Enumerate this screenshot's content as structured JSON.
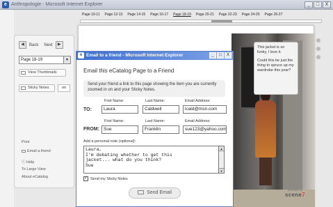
{
  "window": {
    "title": "Anthropologie - Microsoft Internet Explorer",
    "minimize": "_",
    "maximize": "□",
    "close": "X"
  },
  "page_tabs": [
    "Page 10-11",
    "Page 12-13",
    "Page 14-15",
    "Page 16-17",
    "Page 18-19",
    "Page 20-21",
    "Page 22-23",
    "Page 24-25",
    "Page 26-27"
  ],
  "active_page_tab": "Page 18-19",
  "panel": {
    "back_label": "Back",
    "next_label": "Next",
    "page_select_value": "Page 18-19",
    "view_thumbnails": "View Thumbnails",
    "sticky_notes": "Sticky Notes",
    "sticky_state": "on",
    "print": "Print",
    "email_friend": "Email a friend",
    "help": "Help",
    "larger_view": "To Large View",
    "about": "About eCatalog"
  },
  "sticky_note": {
    "line1": "This jacket is so funky, I love it.",
    "line2": "Could this be just the thing to spruce up my wardrobe this year?"
  },
  "powered_by": {
    "caption": "powered by",
    "brand": "scene",
    "brand_accent": "7"
  },
  "dialog": {
    "title": "Email to a friend - Microsoft Internet Explorer",
    "heading": "Email this eCatalog Page to a Friend",
    "description": "Send your friend a link to this page showing the item you are currently zoomed in on and your Sticky Notes.",
    "col_first": "First Name:",
    "col_last": "Last Name:",
    "col_email": "Email Address:",
    "to_label": "TO:",
    "from_label": "FROM:",
    "to": {
      "first": "Laura",
      "last": "Caldwell",
      "email": "lcald@msn.com"
    },
    "from": {
      "first": "Sue",
      "last": "Franklin",
      "email": "sue123@yahoo.com"
    },
    "note_caption": "Add a personal note (optional):",
    "note_text": "Laura,\nI'm debating whether to get this\njacket... what do you think?\nSue",
    "send_sticky_label": "Send my Sticky Notes",
    "send_sticky_checked": true,
    "send_button": "Send Email"
  }
}
